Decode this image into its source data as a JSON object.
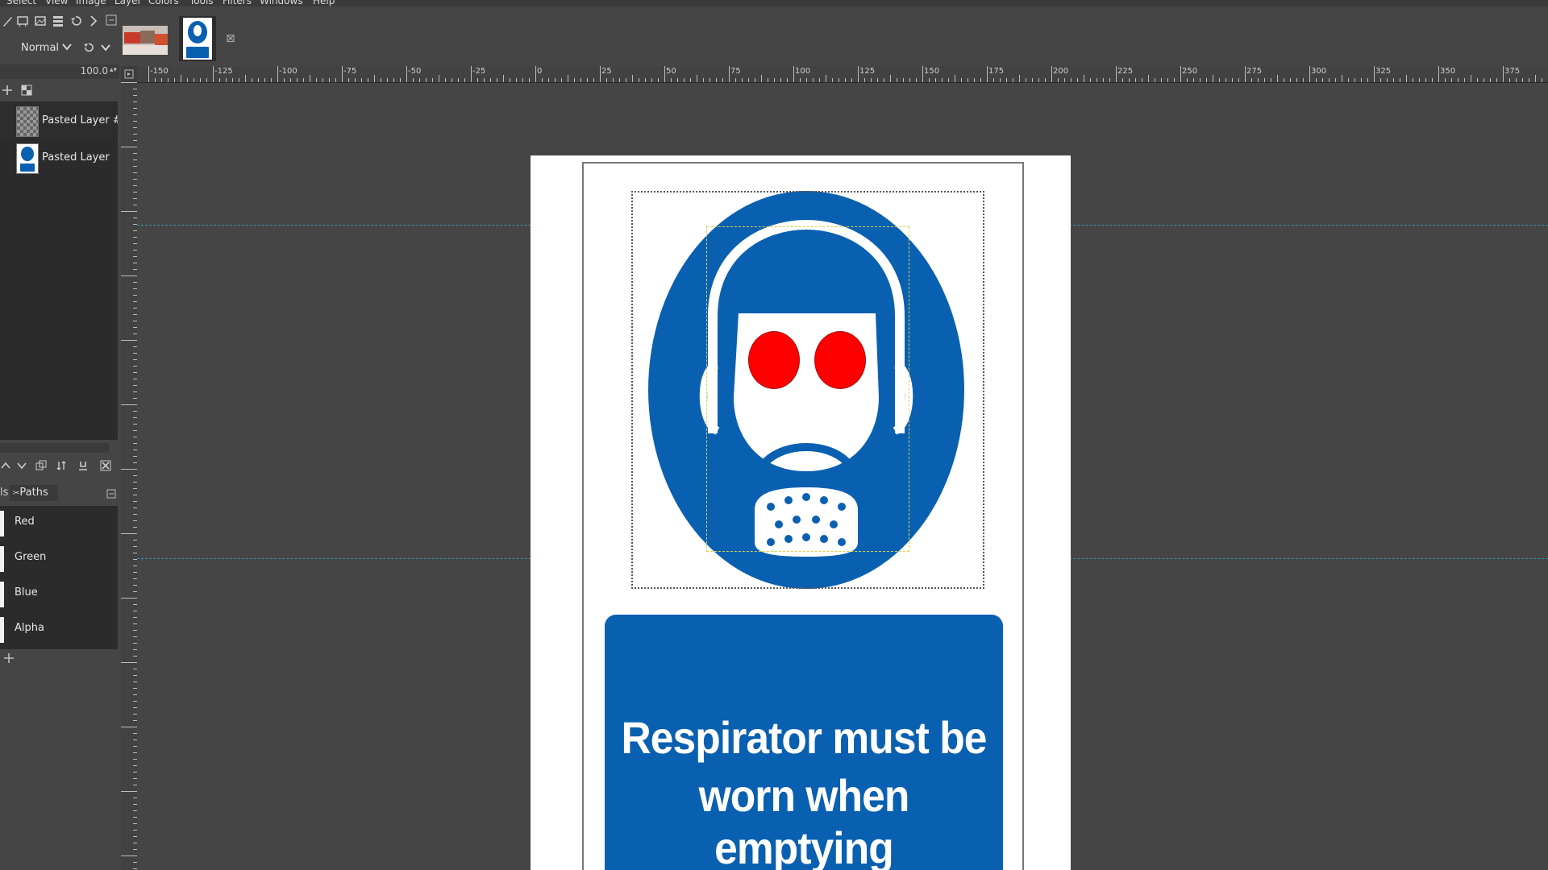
{
  "menubar": {
    "items": [
      "Select",
      "View",
      "Image",
      "Layer",
      "Colors",
      "Tools",
      "Filters",
      "Windows",
      "Help"
    ]
  },
  "tool_options": {
    "mode": "Normal",
    "opacity": "100.0"
  },
  "layers": [
    {
      "name": "Pasted Layer #"
    },
    {
      "name": "Pasted Layer"
    }
  ],
  "dock_tabs": {
    "paths_label": "Paths",
    "left_fragment": "ls"
  },
  "channels": [
    {
      "name": "Red"
    },
    {
      "name": "Green"
    },
    {
      "name": "Blue"
    },
    {
      "name": "Alpha"
    }
  ],
  "ruler": {
    "h_ticks": [
      "-150",
      "-125",
      "-100",
      "-75",
      "-50",
      "-25",
      "0",
      "25",
      "50",
      "75",
      "100",
      "125",
      "150",
      "175",
      "200",
      "225",
      "250",
      "275",
      "300",
      "325",
      "350",
      "375"
    ]
  },
  "sign": {
    "line1": "Respirator must be",
    "line2": "worn when emptying"
  },
  "colors": {
    "sign_blue": "#0a60b0",
    "eye_red": "#ff0000",
    "guide": "#3b8fb0"
  }
}
